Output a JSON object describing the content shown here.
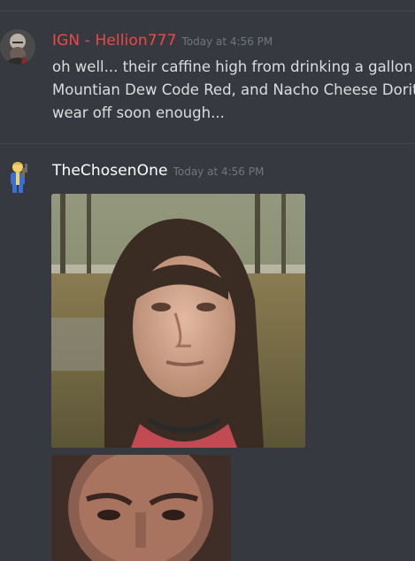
{
  "messages": [
    {
      "username": "IGN - Hellion777",
      "timestamp": "Today at 4:56 PM",
      "avatar": "warrior-avatar-icon",
      "name_color": "#f04747",
      "lines": [
        "oh well... their caffine high from drinking a gallon of",
        "Mountian Dew Code Red, and Nacho Cheese Doritos",
        "wear off soon enough..."
      ]
    },
    {
      "username": "TheChosenOne",
      "timestamp": "Today at 4:56 PM",
      "avatar": "vault-boy-avatar-icon",
      "name_color": "#ffffff",
      "attachments": [
        {
          "type": "image",
          "description_icon": "selfie-photo-icon"
        },
        {
          "type": "image",
          "description_icon": "face-closeup-photo-icon"
        }
      ]
    }
  ],
  "colors": {
    "background": "#36393f",
    "text": "#dcddde",
    "timestamp": "#72767d"
  }
}
